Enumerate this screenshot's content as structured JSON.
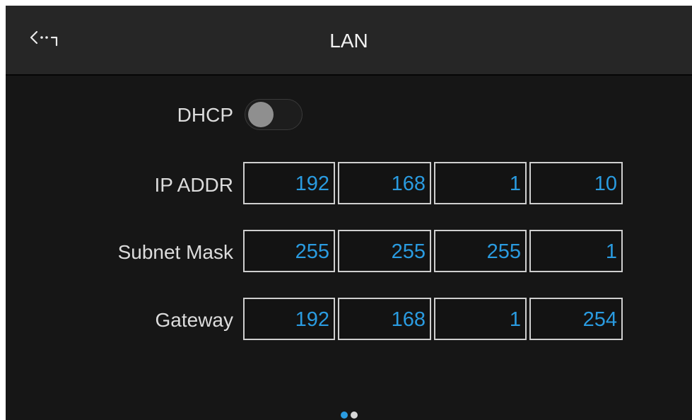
{
  "header": {
    "title": "LAN",
    "back_icon": "back-arrow-icon"
  },
  "dhcp": {
    "label": "DHCP",
    "enabled": false
  },
  "fields": [
    {
      "label": "IP ADDR",
      "octets": [
        "192",
        "168",
        "1",
        "10"
      ]
    },
    {
      "label": "Subnet Mask",
      "octets": [
        "255",
        "255",
        "255",
        "1"
      ]
    },
    {
      "label": "Gateway",
      "octets": [
        "192",
        "168",
        "1",
        "254"
      ]
    }
  ],
  "pager": {
    "pages": 2,
    "current": 1
  },
  "colors": {
    "accent": "#2a9be0",
    "background": "#161616",
    "header": "#262626",
    "label": "#dcdcdc"
  }
}
